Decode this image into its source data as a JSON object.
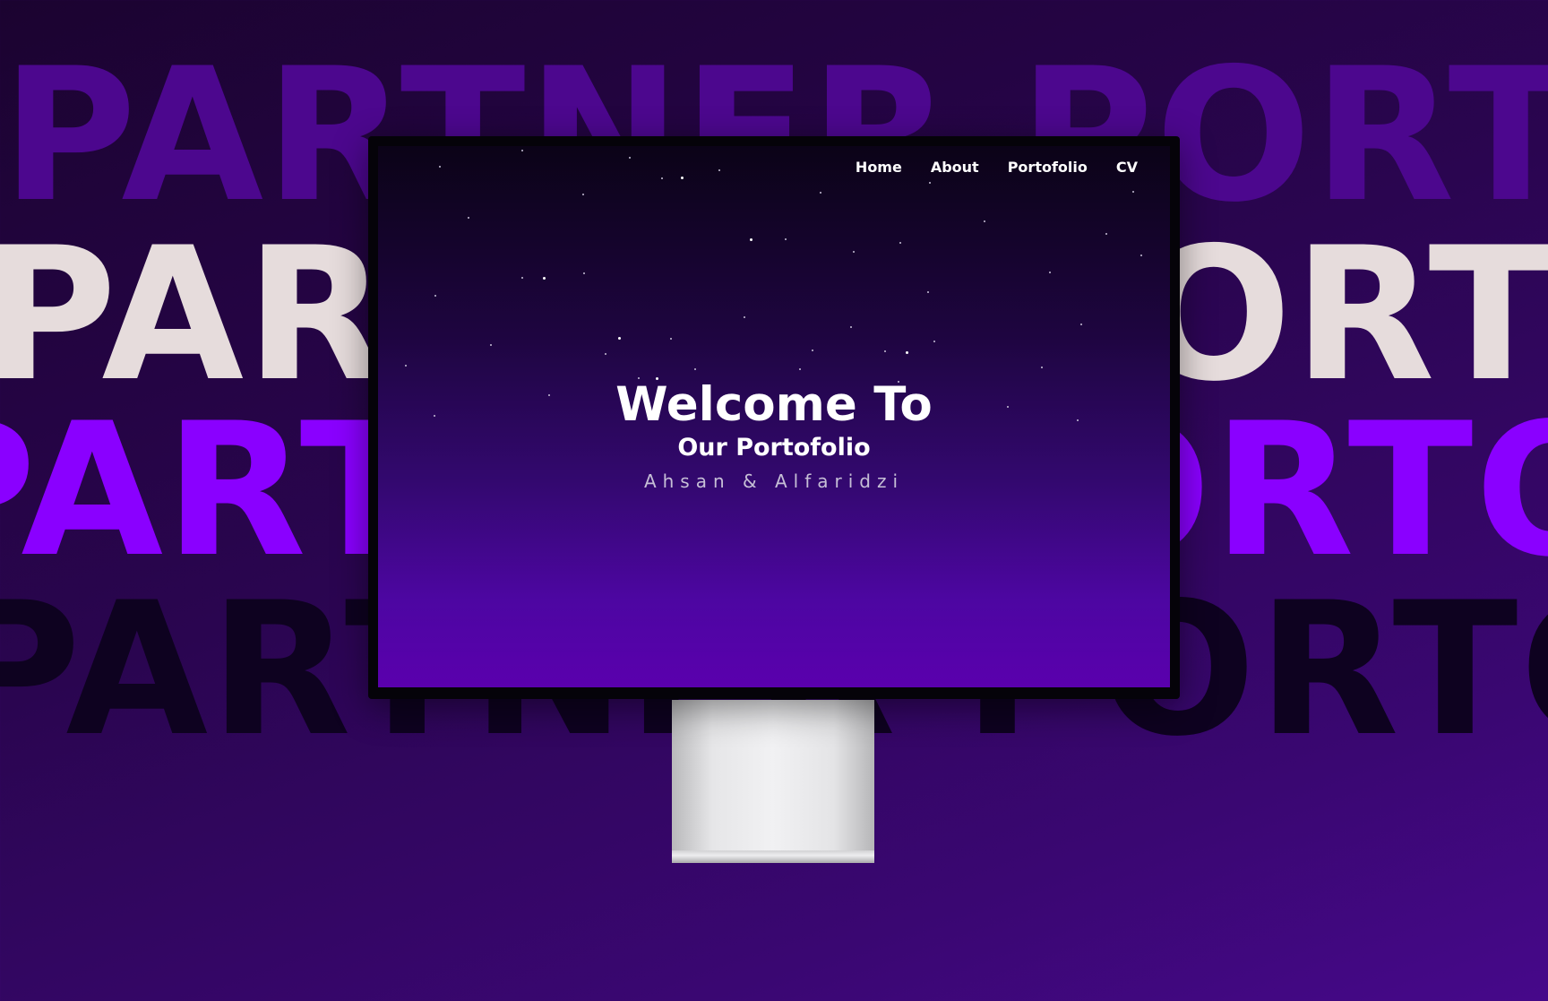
{
  "background_words": {
    "row1": "PARTNER PORTOFOLIO",
    "row2": "PARTNER PORTOFOLIO",
    "row3": "PARTNER PORTOFOLIO",
    "row4": "PARTNER PORTOFOLIO"
  },
  "colors": {
    "row1": "#4c078e",
    "row2": "#e6dcdc",
    "row3": "#8a00ff",
    "row4": "#0e0220",
    "accent": "#5a00ad"
  },
  "nav": {
    "items": [
      "Home",
      "About",
      "Portofolio",
      "CV"
    ]
  },
  "hero": {
    "title": "Welcome To",
    "subtitle": "Our Portofolio",
    "names": "Ahsan & Alfaridzi"
  }
}
